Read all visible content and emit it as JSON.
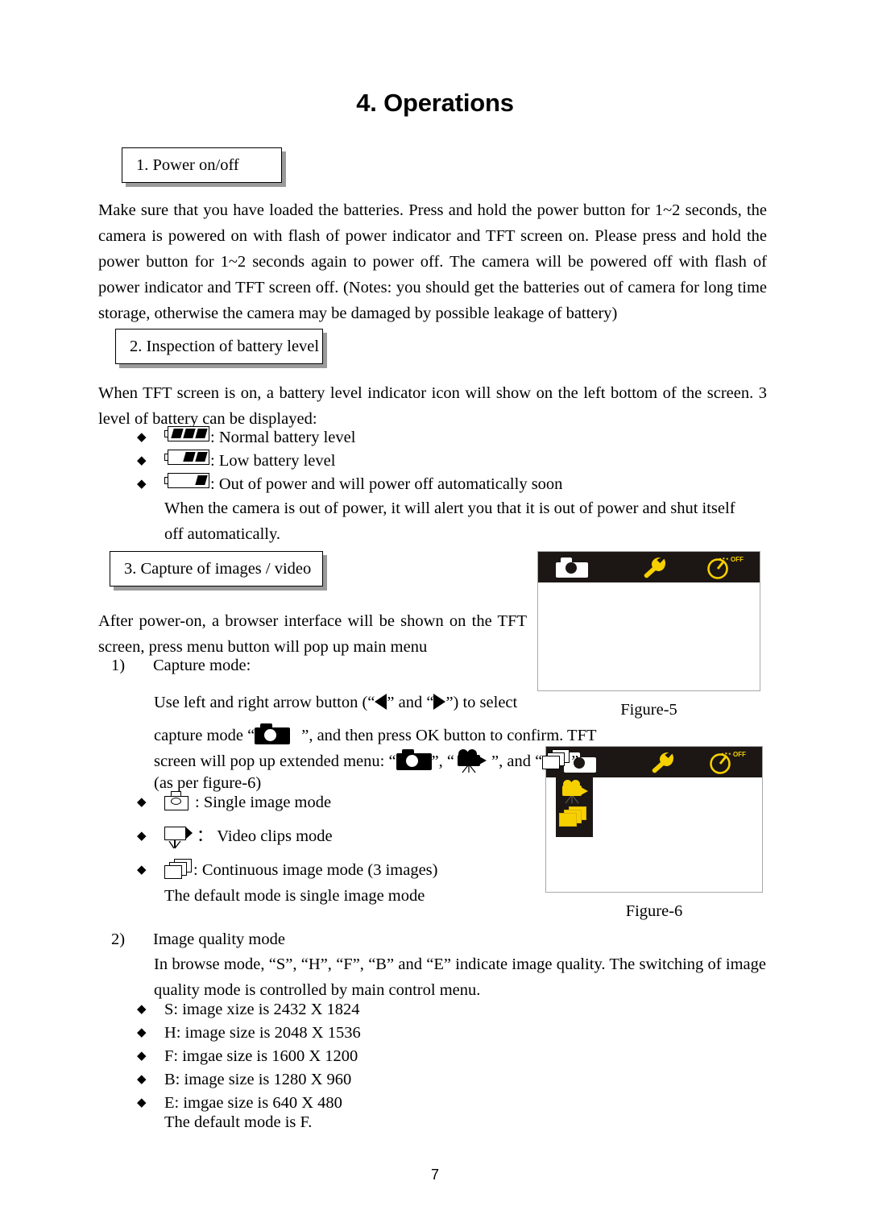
{
  "document": {
    "title": "4. Operations",
    "page_number": "7"
  },
  "sections": [
    {
      "id": "power",
      "heading": "1. Power on/off"
    },
    {
      "id": "battery",
      "heading": "2. Inspection of battery level"
    },
    {
      "id": "capture",
      "heading": "3.  Capture  of  images  /  video"
    }
  ],
  "power": {
    "body": "Make sure that you have loaded the batteries. Press and hold the power button for 1~2 seconds, the camera is powered on with flash of power indicator and TFT screen on. Please press and hold the power button for 1~2 seconds again to power off. The camera will be powered off with flash of power indicator and TFT screen off. (Notes: you should get the batteries out of camera for long time storage, otherwise the camera may be damaged by possible leakage of battery)"
  },
  "battery": {
    "intro": "When TFT screen is on, a battery level indicator icon will show on the left bottom of the screen. 3 level of battery can be displayed:",
    "levels": [
      {
        "icon": "battery-full-icon",
        "segments": 3,
        "label": ": Normal battery level"
      },
      {
        "icon": "battery-low-icon",
        "segments": 2,
        "label": ": Low battery level"
      },
      {
        "icon": "battery-empty-icon",
        "segments": 1,
        "label": ": Out of power and will power off automatically soon"
      }
    ],
    "note": "When the camera is out of power, it will alert you that it is out of power and shut itself off automatically."
  },
  "capture": {
    "intro": "After power-on, a browser interface will be shown on the TFT screen, press menu button will pop up main menu",
    "item1_number": "1)",
    "item1_title": "Capture mode:",
    "instr_a_pre": "Use left and right arrow button (“",
    "instr_a_mid": "” and “",
    "instr_a_post": "”) to select",
    "instr_b_pre": "capture mode “",
    "instr_b_post": "”, and then press OK button to confirm. TFT",
    "instr_c_pre": "screen will pop up extended menu: “",
    "instr_c_mid1": "”, “",
    "instr_c_mid2": "”, and “",
    "instr_c_post": "”",
    "instr_d": "(as per figure-6)",
    "modes": [
      {
        "icon": "single-image-icon",
        "label": ": Single image mode"
      },
      {
        "icon": "video-clip-icon",
        "label": "： Video clips mode"
      },
      {
        "icon": "continuous-image-icon",
        "label": ": Continuous image mode (3 images)"
      }
    ],
    "default_note": "The default mode is single image mode"
  },
  "quality": {
    "number": "2)",
    "title": "Image quality mode",
    "body": "In browse mode, “S”, “H”, “F”, “B” and “E” indicate image quality. The switching of image quality mode is controlled by main control menu.",
    "items": [
      "S: image xize is 2432 X 1824",
      "H: image size is 2048 X 1536",
      "F: imgae size is 1600 X 1200",
      "B: image size is 1280 X 960",
      "E: imgae size is 640 X 480"
    ],
    "default_note": "The default mode is F."
  },
  "figures": [
    {
      "id": "figure-5",
      "caption": "Figure-5",
      "menubar_icons": [
        "camera-icon",
        "wrench-icon",
        "timer-off-icon"
      ],
      "timer_label": "OFF",
      "dropdown_open": false
    },
    {
      "id": "figure-6",
      "caption": "Figure-6",
      "menubar_icons": [
        "camera-icon",
        "wrench-icon",
        "timer-off-icon"
      ],
      "timer_label": "OFF",
      "dropdown_open": true,
      "dropdown_icons": [
        "video-clip-icon",
        "continuous-image-icon"
      ]
    }
  ],
  "colors": {
    "menubar_bg": "#1c1714",
    "accent_yellow": "#f7d000",
    "icon_white": "#ffffff",
    "box_shadow": "#9a9a9a"
  }
}
